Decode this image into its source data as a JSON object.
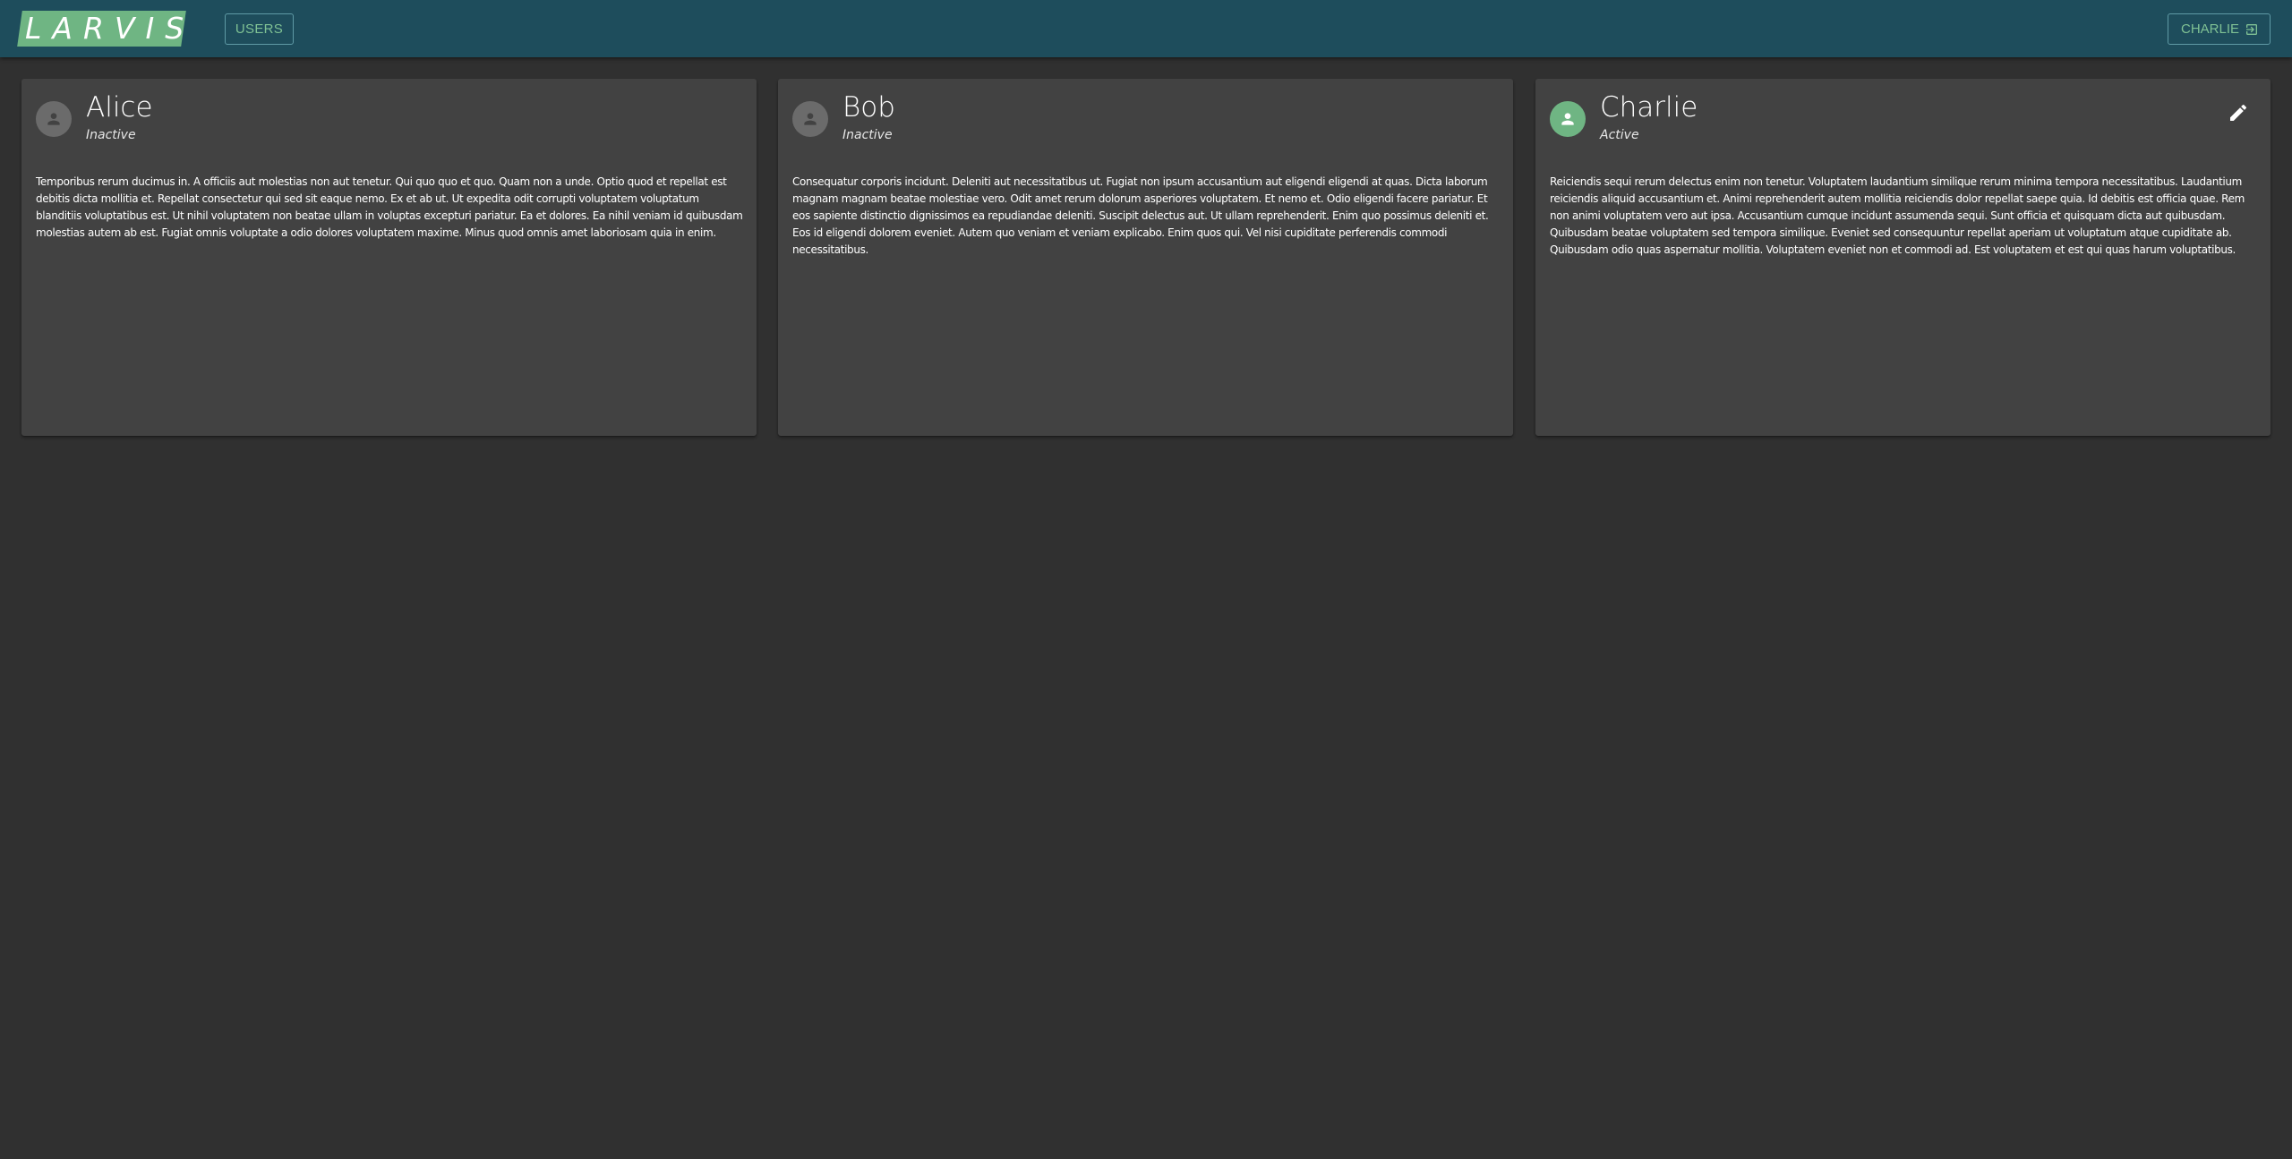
{
  "app": {
    "logo_text": "LARVIS"
  },
  "nav": {
    "users_label": "USERS"
  },
  "account": {
    "user_label": "CHARLIE",
    "icon": "logout-icon"
  },
  "colors": {
    "topbar": "#1e4d5c",
    "accent": "#6fb583",
    "background": "#303030",
    "card": "#424242",
    "inactive_avatar": "#6b6b6b"
  },
  "cards": [
    {
      "name": "Alice",
      "status": "Inactive",
      "active": false,
      "text": "Temporibus rerum ducimus in. A officiis aut molestias non aut tenetur. Qui quo quo et quo. Quam non a unde. Optio quod et repellat est debitis dicta mollitia et. Repellat consectetur qui sed sit eaque nemo. Ex et ab ut. Ut expedita odit corrupti voluptatem voluptatum blanditiis voluptatibus est. Ut nihil voluptatem non beatae ullam in voluptas excepturi pariatur. Ea et dolores. Ea nihil veniam id quibusdam molestias autem ab est. Fugiat omnis voluptate a odio dolores voluptatem maxime. Minus quod omnis amet laboriosam quia in enim."
    },
    {
      "name": "Bob",
      "status": "Inactive",
      "active": false,
      "text": "Consequatur corporis incidunt. Deleniti aut necessitatibus ut. Fugiat non ipsum accusantium aut eligendi eligendi at quas. Dicta laborum magnam magnam beatae molestiae vero. Odit amet rerum dolorum asperiores voluptatem. Et nemo et. Odio eligendi facere pariatur. Et eos sapiente distinctio dignissimos ea repudiandae deleniti. Suscipit delectus aut. Ut ullam reprehenderit. Enim quo possimus deleniti et. Eos id eligendi dolorem eveniet. Autem quo veniam et veniam explicabo. Enim quos qui. Vel nisi cupiditate perferendis commodi necessitatibus."
    },
    {
      "name": "Charlie",
      "status": "Active",
      "active": true,
      "text": "Reiciendis sequi rerum delectus enim non tenetur. Voluptatem laudantium similique rerum minima tempora necessitatibus. Laudantium reiciendis aliquid accusantium et. Animi reprehenderit autem mollitia reiciendis dolor repellat saepe quia. Id debitis est officia quae. Rem non animi voluptatem vero aut ipsa. Accusantium cumque incidunt assumenda sequi. Sunt officia et quisquam dicta aut quibusdam. Quibusdam beatae voluptatem sed tempora similique. Eveniet sed consequuntur repellat aperiam ut voluptatum atque cupiditate ab. Quibusdam odio quas aspernatur mollitia. Voluptatem eveniet non et commodi ad. Est voluptatem et est qui quas harum voluptatibus."
    }
  ]
}
